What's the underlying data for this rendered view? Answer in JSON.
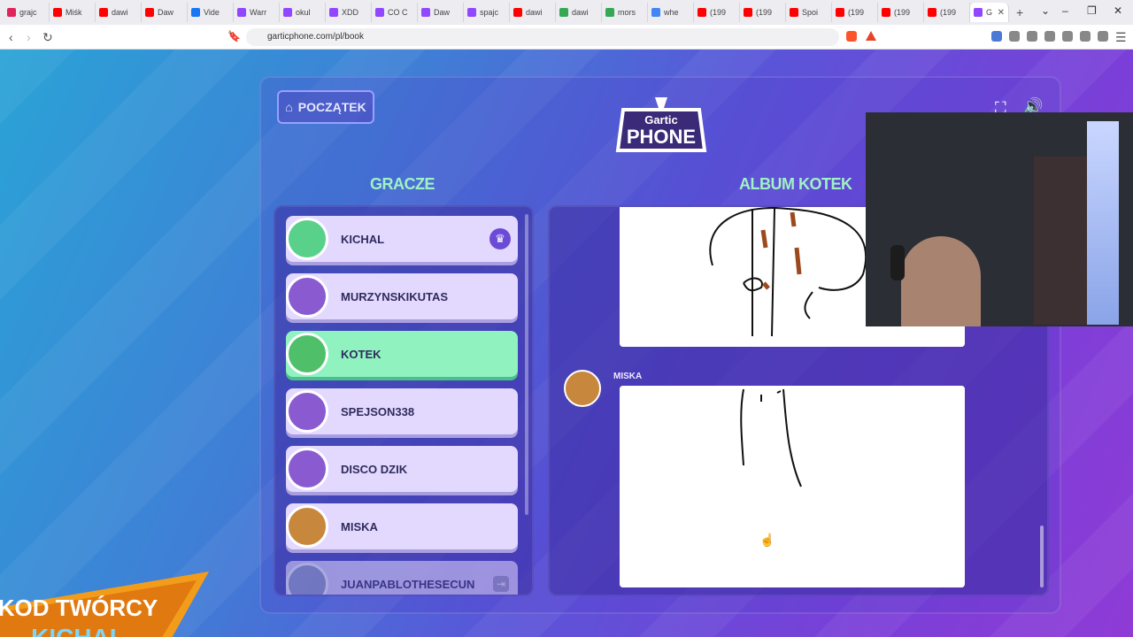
{
  "browser": {
    "tabs": [
      {
        "label": "grajc",
        "color": "#e0245e"
      },
      {
        "label": "Miśk",
        "color": "#ff0000"
      },
      {
        "label": "dawi",
        "color": "#ff0000"
      },
      {
        "label": "Daw",
        "color": "#ff0000"
      },
      {
        "label": "Vide",
        "color": "#1877f2"
      },
      {
        "label": "Warr",
        "color": "#9146ff"
      },
      {
        "label": "okul",
        "color": "#9146ff"
      },
      {
        "label": "XDD",
        "color": "#9146ff"
      },
      {
        "label": "CO C",
        "color": "#9146ff"
      },
      {
        "label": "Daw",
        "color": "#9146ff"
      },
      {
        "label": "spajc",
        "color": "#9146ff"
      },
      {
        "label": "dawi",
        "color": "#ff0000"
      },
      {
        "label": "dawi",
        "color": "#34a853"
      },
      {
        "label": "mors",
        "color": "#34a853"
      },
      {
        "label": "whe",
        "color": "#4285f4"
      },
      {
        "label": "(199",
        "color": "#ff0000"
      },
      {
        "label": "(199",
        "color": "#ff0000"
      },
      {
        "label": "Spoi",
        "color": "#ff0000"
      },
      {
        "label": "(199",
        "color": "#ff0000"
      },
      {
        "label": "(199",
        "color": "#ff0000"
      },
      {
        "label": "(199",
        "color": "#ff0000"
      },
      {
        "label": "G",
        "color": "#9146ff"
      }
    ],
    "url": "garticphone.com/pl/book"
  },
  "game": {
    "home_button": "POCZĄTEK",
    "logo_top": "Gartic",
    "logo_bottom": "PHONE",
    "players_title": "GRACZE",
    "album_title": "ALBUM KOTEK",
    "players": [
      {
        "name": "KICHAL",
        "avatar_color": "#5ad18a",
        "host": true
      },
      {
        "name": "MURZYNSKIKUTAS",
        "avatar_color": "#8a5ad1",
        "host": false
      },
      {
        "name": "KOTEK",
        "avatar_color": "#4fbf6a",
        "host": false
      },
      {
        "name": "SPEJSON338",
        "avatar_color": "#8a5ad1",
        "host": false
      },
      {
        "name": "DISCO DZIK",
        "avatar_color": "#8a5ad1",
        "host": false
      },
      {
        "name": "MISKA",
        "avatar_color": "#c7873c",
        "host": false
      },
      {
        "name": "JUANPABLOTHESECUN",
        "avatar_color": "#9aa0c8",
        "host": false
      }
    ],
    "album_entry_author": "MISKA",
    "promo_line1": "KOD TWÓRCY",
    "promo_line2": "KICHAL"
  }
}
